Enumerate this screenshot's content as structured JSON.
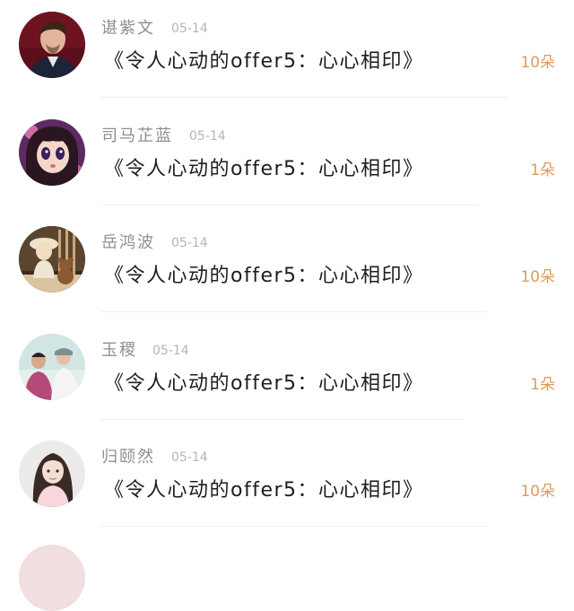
{
  "list": {
    "items": [
      {
        "name": "谌紫文",
        "date": "05-14",
        "gift": "《令人心动的offer5：心心相印》",
        "count": "10朵",
        "avatar_icon": "avatar-man-suit"
      },
      {
        "name": "司马芷蓝",
        "date": "05-14",
        "gift": "《令人心动的offer5：心心相印》",
        "count": "1朵",
        "avatar_icon": "avatar-anime-girl"
      },
      {
        "name": "岳鸿波",
        "date": "05-14",
        "gift": "《令人心动的offer5：心心相印》",
        "count": "10朵",
        "avatar_icon": "avatar-child-teddy"
      },
      {
        "name": "玉稷",
        "date": "05-14",
        "gift": "《令人心动的offer5：心心相印》",
        "count": "1朵",
        "avatar_icon": "avatar-couple"
      },
      {
        "name": "归颐然",
        "date": "05-14",
        "gift": "《令人心动的offer5：心心相印》",
        "count": "10朵",
        "avatar_icon": "avatar-girl-portrait"
      }
    ]
  },
  "colors": {
    "name": "#8f8f8f",
    "date": "#b5b5b5",
    "gift": "#1e1e1e",
    "count": "#e09a5c",
    "divider": "#eeeeee"
  }
}
